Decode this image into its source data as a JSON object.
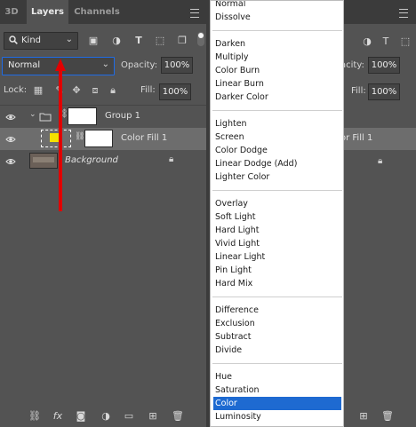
{
  "tabs": [
    {
      "label": "3D",
      "active": false
    },
    {
      "label": "Layers",
      "active": true
    },
    {
      "label": "Channels",
      "active": false
    }
  ],
  "filter": {
    "kind_label": "Kind"
  },
  "blend_mode": {
    "selected": "Normal"
  },
  "opacity": {
    "label": "Opacity:",
    "value": "100%"
  },
  "fill": {
    "label": "Fill:",
    "value": "100%"
  },
  "lock": {
    "label": "Lock:"
  },
  "layers": [
    {
      "name": "Group 1",
      "type": "group",
      "selected": false
    },
    {
      "name": "Color Fill 1",
      "type": "fill",
      "selected": true
    },
    {
      "name": "Background",
      "type": "background",
      "locked": true,
      "selected": false
    }
  ],
  "footer": {
    "fx_label": "fx"
  },
  "dropdown": {
    "groups": [
      [
        "Normal",
        "Dissolve"
      ],
      [
        "Darken",
        "Multiply",
        "Color Burn",
        "Linear Burn",
        "Darker Color"
      ],
      [
        "Lighten",
        "Screen",
        "Color Dodge",
        "Linear Dodge (Add)",
        "Lighter Color"
      ],
      [
        "Overlay",
        "Soft Light",
        "Hard Light",
        "Vivid Light",
        "Linear Light",
        "Pin Light",
        "Hard Mix"
      ],
      [
        "Difference",
        "Exclusion",
        "Subtract",
        "Divide"
      ],
      [
        "Hue",
        "Saturation",
        "Color",
        "Luminosity"
      ]
    ],
    "highlighted": "Color"
  },
  "right_panel": {
    "opacity_label": "acity:",
    "opacity_value": "100%",
    "fill_label": "Fill:",
    "fill_value": "100%",
    "layer_name": "or Fill 1"
  },
  "colors": {
    "highlight": "#1e6ad1",
    "arrow": "#e00000",
    "fill_swatch": "#f5e000"
  }
}
